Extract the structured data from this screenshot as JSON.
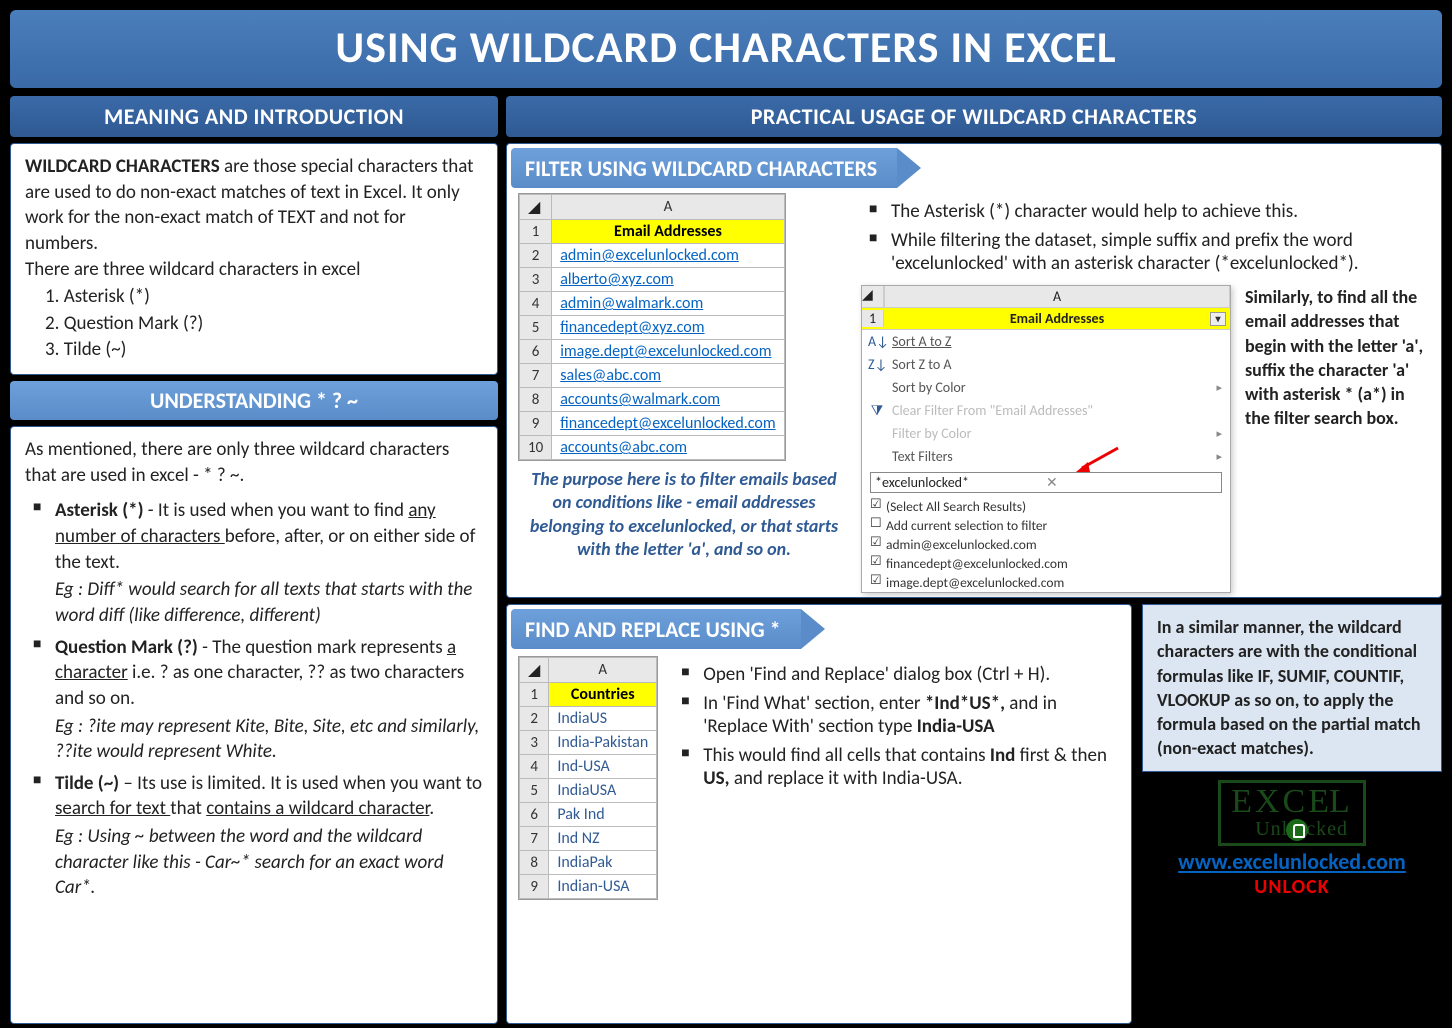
{
  "title": "USING WILDCARD CHARACTERS IN EXCEL",
  "left": {
    "h1": "MEANING AND INTRODUCTION",
    "intro_bold": "WILDCARD CHARACTERS",
    "intro_rest": " are those special characters that are used to do non-exact matches of text in Excel. It only work for the non-exact match of TEXT and not for numbers.",
    "intro_line2": "There are three wildcard characters in excel",
    "list": [
      "1.   Asterisk (*)",
      "2.    Question Mark (?)",
      "3.   Tilde (~)"
    ],
    "h2": "UNDERSTANDING * ? ~",
    "u_intro": "As mentioned, there are only three wildcard characters that are used in excel - * ? ~.",
    "asterisk_label": "Asterisk (*)",
    "asterisk_txt1": " - It is used when you want to find ",
    "asterisk_ul": "any number of characters ",
    "asterisk_txt2": "before, after, or on either side of the text.",
    "asterisk_eg": "Eg :  Diff* would search for all texts that starts with the word diff (like difference, different)",
    "qm_label": "Question Mark (?)",
    "qm_txt1": " - The question mark represents ",
    "qm_ul": "a character",
    "qm_txt2": " i.e. ? as one character, ?? as two characters and so on.",
    "qm_eg": "Eg : ?ite may represent Kite, Bite, Site, etc and similarly, ??ite would represent White.",
    "tilde_label": "Tilde (~)",
    "tilde_txt1": " – Its  use is limited. It is used when you want to ",
    "tilde_ul1": "search for text ",
    "tilde_mid": "that ",
    "tilde_ul2": "contains a wildcard character",
    "tilde_dot": ".",
    "tilde_eg": "Eg : Using ~ between the word and the wildcard character like this - Car~* search for an exact word Car*."
  },
  "right": {
    "h1": "PRACTICAL USAGE OF WILDCARD CHARACTERS",
    "filter_h": "FILTER USING WILDCARD CHARACTERS",
    "emails_header": "Email Addresses",
    "emails": [
      "admin@excelunlocked.com",
      "alberto@xyz.com",
      "admin@walmark.com",
      "financedept@xyz.com",
      "image.dept@excelunlocked.com",
      "sales@abc.com",
      "accounts@walmark.com",
      "financedept@excelunlocked.com",
      "accounts@abc.com"
    ],
    "caption": "The purpose here is to filter emails based on conditions like - email addresses belonging to excelunlocked, or that starts with the letter 'a', and so on.",
    "filter_b1": "The Asterisk (*) character would help to achieve this.",
    "filter_b2": "While filtering the dataset, simple suffix and prefix the word 'excelunlocked' with an asterisk character (*excelunlocked*).",
    "filter_menu": {
      "col": "A",
      "header": "Email Addresses",
      "sort_az": "Sort A to Z",
      "sort_za": "Sort Z to A",
      "sort_color": "Sort by Color",
      "clear": "Clear Filter From \"Email Addresses\"",
      "filter_color": "Filter by Color",
      "text_filters": "Text Filters",
      "search": "*excelunlocked*",
      "checks": [
        {
          "label": "(Select All Search Results)",
          "checked": true
        },
        {
          "label": "Add current selection to filter",
          "checked": false
        },
        {
          "label": "admin@excelunlocked.com",
          "checked": true
        },
        {
          "label": "financedept@excelunlocked.com",
          "checked": true
        },
        {
          "label": "image.dept@excelunlocked.com",
          "checked": true
        }
      ]
    },
    "side_note": "Similarly, to find all the email addresses that begin with the letter 'a', suffix the character 'a' with asterisk * (a*) in the filter search box.",
    "find_h": "FIND AND REPLACE USING *",
    "countries_header": "Countries",
    "countries": [
      "IndiaUS",
      "India-Pakistan",
      "Ind-USA",
      "IndiaUSA",
      "Pak Ind",
      "Ind NZ",
      "IndiaPak",
      "Indian-USA"
    ],
    "find_b1": "Open 'Find and Replace' dialog box (Ctrl + H).",
    "find_b2a": "In 'Find What' section, enter ",
    "find_b2b": "*Ind*US*,",
    "find_b2c": " and in 'Replace With' section type ",
    "find_b2d": "India-USA",
    "find_b3a": "This would find all cells that contains ",
    "find_b3b": "Ind",
    "find_b3c": " first & then ",
    "find_b3d": "US,",
    "find_b3e": " and replace it with India-USA.",
    "info": "In a similar manner, the wildcard characters are with the conditional formulas like IF, SUMIF, COUNTIF, VLOOKUP as so on, to apply the formula based on the partial match (non-exact matches).",
    "site": "www.excelunlocked.com",
    "unlock": "UNLOCK"
  }
}
